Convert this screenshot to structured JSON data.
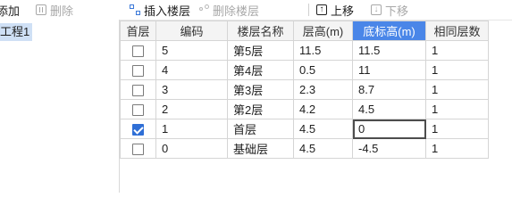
{
  "toolbar": {
    "add_label": "添加",
    "delete_label": "删除",
    "insert_floor_label": "插入楼层",
    "delete_floor_label": "删除楼层",
    "move_up_label": "上移",
    "move_down_label": "下移"
  },
  "tree": {
    "selected_item": "工程1"
  },
  "table": {
    "headers": [
      "首层",
      "编码",
      "楼层名称",
      "层高(m)",
      "底标高(m)",
      "相同层数"
    ],
    "active_header_index": 4,
    "rows": [
      {
        "checked": false,
        "code": "5",
        "name": "第5层",
        "height": "11.5",
        "bottom_elev": "11.5",
        "same_count": "1"
      },
      {
        "checked": false,
        "code": "4",
        "name": "第4层",
        "height": "0.5",
        "bottom_elev": "11",
        "same_count": "1"
      },
      {
        "checked": false,
        "code": "3",
        "name": "第3层",
        "height": "2.3",
        "bottom_elev": "8.7",
        "same_count": "1"
      },
      {
        "checked": false,
        "code": "2",
        "name": "第2层",
        "height": "4.2",
        "bottom_elev": "4.5",
        "same_count": "1"
      },
      {
        "checked": true,
        "code": "1",
        "name": "首层",
        "height": "4.5",
        "bottom_elev": "0",
        "same_count": "1"
      },
      {
        "checked": false,
        "code": "0",
        "name": "基础层",
        "height": "4.5",
        "bottom_elev": "-4.5",
        "same_count": "1"
      }
    ],
    "editing_row_index": 4
  },
  "colors": {
    "active_header": "#4a86e8",
    "checkbox_checked": "#2f6fd6",
    "tree_selection": "#cfe0f5"
  }
}
